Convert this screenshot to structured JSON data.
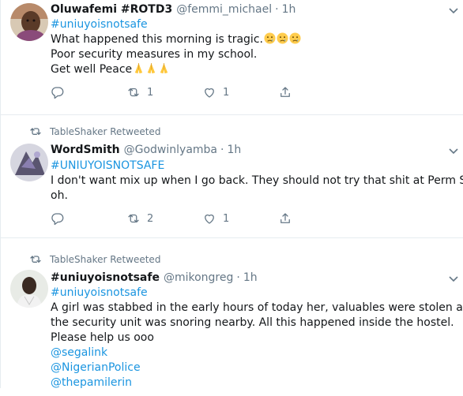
{
  "tweets": [
    {
      "name": "Oluwafemi #ROTD3",
      "handle": "@femmi_michael",
      "dot": "·",
      "time": "1h",
      "lines": [
        "#uniuyoisnotsafe",
        "What happened this morning is tragic.",
        "Poor security measures in my school.",
        "Get well Peace"
      ],
      "reply_count": "",
      "retweet_count": "1",
      "like_count": "1"
    },
    {
      "retweet_context": "TableShaker Retweeted",
      "name": "WordSmith",
      "handle": "@Godwinlyamba",
      "dot": "·",
      "time": "1h",
      "lines": [
        "#UNIUYOISNOTSAFE",
        "I don't want mix up when I go back. They should not try that shit at Perm Site",
        "oh."
      ],
      "reply_count": "",
      "retweet_count": "2",
      "like_count": "1"
    },
    {
      "retweet_context": "TableShaker Retweeted",
      "name": "#uniuyoisnotsafe",
      "handle": "@mikongreg",
      "dot": "·",
      "time": "1h",
      "lines": [
        "#uniuyoisnotsafe",
        "A girl was stabbed in the early hours of today her, valuables were stolen and",
        "the security unit was snoring nearby. All this happened inside the hostel.",
        "Please help us ooo",
        "@segalink",
        "@NigerianPolice",
        "@thepamilerin"
      ]
    }
  ],
  "colors": {
    "link": "#1b95e0",
    "muted": "#657786",
    "text": "#14171a",
    "divider": "#e6ecf0"
  }
}
